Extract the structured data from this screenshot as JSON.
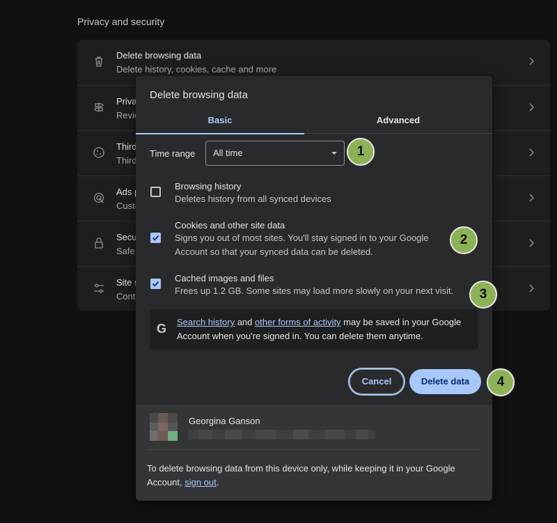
{
  "settings": {
    "section_title": "Privacy and security",
    "rows": [
      {
        "title": "Delete browsing data",
        "sub": "Delete history, cookies, cache and more",
        "icon": "trash-icon"
      },
      {
        "title": "Priva",
        "sub": "Revie",
        "icon": "signpost-icon"
      },
      {
        "title": "Third",
        "sub": "Third",
        "icon": "cookie-icon"
      },
      {
        "title": "Ads p",
        "sub": "Custo",
        "icon": "ads-icon"
      },
      {
        "title": "Secu",
        "sub": "Safe",
        "icon": "lock-icon"
      },
      {
        "title": "Site s",
        "sub": "Cont",
        "icon": "sliders-icon"
      }
    ]
  },
  "dialog": {
    "title": "Delete browsing data",
    "tabs": [
      {
        "label": "Basic",
        "active": true
      },
      {
        "label": "Advanced",
        "active": false
      }
    ],
    "time_range": {
      "label": "Time range",
      "value": "All time"
    },
    "options": [
      {
        "title": "Browsing history",
        "desc": "Deletes history from all synced devices",
        "checked": false
      },
      {
        "title": "Cookies and other site data",
        "desc": "Signs you out of most sites. You'll stay signed in to your Google Account so that your synced data can be deleted.",
        "checked": true
      },
      {
        "title": "Cached images and files",
        "desc": "Frees up 1.2 GB. Some sites may load more slowly on your next visit.",
        "checked": true
      }
    ],
    "info": {
      "icon": "google-icon",
      "link1": "Search history",
      "mid": " and ",
      "link2": "other forms of activity",
      "rest": " may be saved in your Google Account when you're signed in. You can delete them anytime."
    },
    "buttons": {
      "cancel": "Cancel",
      "delete": "Delete data"
    },
    "account": {
      "name": "Georgina Ganson"
    },
    "footer": {
      "text": "To delete browsing data from this device only, while keeping it in your Google Account, ",
      "link": "sign out",
      "end": "."
    }
  },
  "callouts": [
    "1",
    "2",
    "3",
    "4"
  ],
  "colors": {
    "accent": "#a8c7fa",
    "callout": "#8db255",
    "dialog_bg": "#282a2c"
  }
}
